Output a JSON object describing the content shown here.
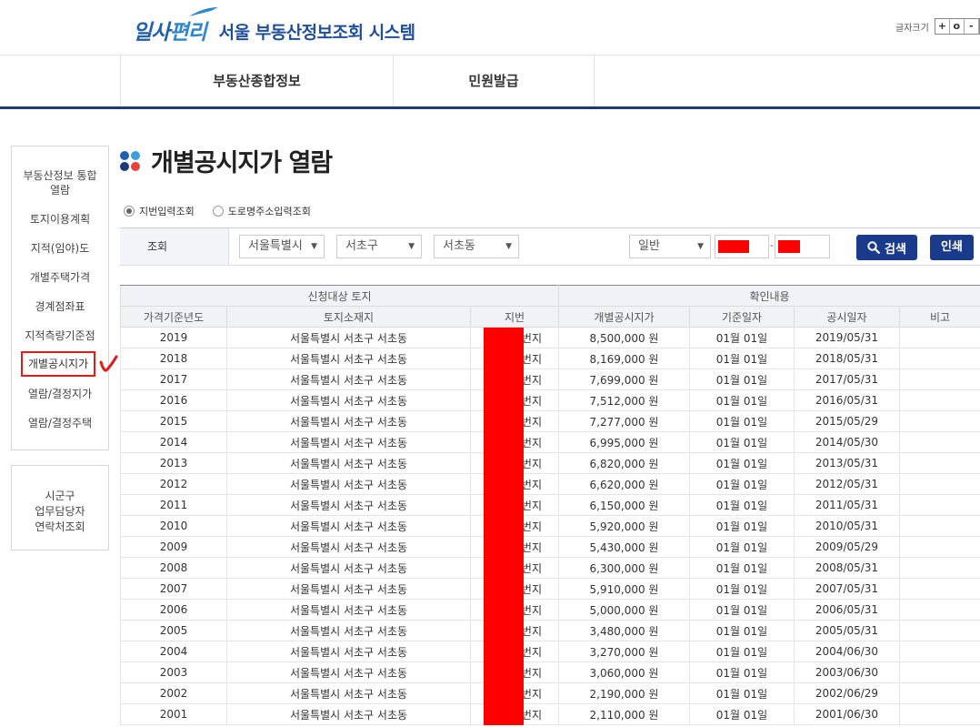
{
  "header": {
    "logo_brand_1": "일사",
    "logo_brand_2": "편리",
    "site_title": "서울 부동산정보조회 시스템",
    "fontsize_label": "글자크기",
    "fontsize_buttons": [
      "+",
      "o",
      "-"
    ]
  },
  "topnav": {
    "items": [
      "부동산종합정보",
      "민원발급"
    ]
  },
  "sidebar": {
    "items": [
      "부동산정보 통합\n열람",
      "토지이용계획",
      "지적(임야)도",
      "개별주택가격",
      "경계점좌표",
      "지적측량기준점",
      "개별공시지가",
      "열람/결정지가",
      "열람/결정주택"
    ],
    "contact": "시군구\n업무담당자\n연락처조회"
  },
  "page": {
    "title": "개별공시지가 열람"
  },
  "search": {
    "radio_options": [
      "지번입력조회",
      "도로명주소입력조회"
    ],
    "label": "조회",
    "sido": "서울특별시",
    "sigungu": "서초구",
    "dong": "서초동",
    "type": "일반",
    "dash": "-",
    "search_button": "검색",
    "print_button": "인쇄"
  },
  "table": {
    "group_headers": [
      "신청대상 토지",
      "확인내용"
    ],
    "headers": [
      "가격기준년도",
      "토지소재지",
      "지번",
      "개별공시지가",
      "기준일자",
      "공시일자",
      "비고"
    ],
    "rows": [
      {
        "year": "2019",
        "location": "서울특별시 서초구 서초동",
        "jibun": "번지",
        "price": "8,500,000 원",
        "base_date": "01월 01일",
        "notice_date": "2019/05/31",
        "note": ""
      },
      {
        "year": "2018",
        "location": "서울특별시 서초구 서초동",
        "jibun": "번지",
        "price": "8,169,000 원",
        "base_date": "01월 01일",
        "notice_date": "2018/05/31",
        "note": ""
      },
      {
        "year": "2017",
        "location": "서울특별시 서초구 서초동",
        "jibun": "번지",
        "price": "7,699,000 원",
        "base_date": "01월 01일",
        "notice_date": "2017/05/31",
        "note": ""
      },
      {
        "year": "2016",
        "location": "서울특별시 서초구 서초동",
        "jibun": "번지",
        "price": "7,512,000 원",
        "base_date": "01월 01일",
        "notice_date": "2016/05/31",
        "note": ""
      },
      {
        "year": "2015",
        "location": "서울특별시 서초구 서초동",
        "jibun": "번지",
        "price": "7,277,000 원",
        "base_date": "01월 01일",
        "notice_date": "2015/05/29",
        "note": ""
      },
      {
        "year": "2014",
        "location": "서울특별시 서초구 서초동",
        "jibun": "번지",
        "price": "6,995,000 원",
        "base_date": "01월 01일",
        "notice_date": "2014/05/30",
        "note": ""
      },
      {
        "year": "2013",
        "location": "서울특별시 서초구 서초동",
        "jibun": "번지",
        "price": "6,820,000 원",
        "base_date": "01월 01일",
        "notice_date": "2013/05/31",
        "note": ""
      },
      {
        "year": "2012",
        "location": "서울특별시 서초구 서초동",
        "jibun": "번지",
        "price": "6,620,000 원",
        "base_date": "01월 01일",
        "notice_date": "2012/05/31",
        "note": ""
      },
      {
        "year": "2011",
        "location": "서울특별시 서초구 서초동",
        "jibun": "번지",
        "price": "6,150,000 원",
        "base_date": "01월 01일",
        "notice_date": "2011/05/31",
        "note": ""
      },
      {
        "year": "2010",
        "location": "서울특별시 서초구 서초동",
        "jibun": "번지",
        "price": "5,920,000 원",
        "base_date": "01월 01일",
        "notice_date": "2010/05/31",
        "note": ""
      },
      {
        "year": "2009",
        "location": "서울특별시 서초구 서초동",
        "jibun": "번지",
        "price": "5,430,000 원",
        "base_date": "01월 01일",
        "notice_date": "2009/05/29",
        "note": ""
      },
      {
        "year": "2008",
        "location": "서울특별시 서초구 서초동",
        "jibun": "번지",
        "price": "6,300,000 원",
        "base_date": "01월 01일",
        "notice_date": "2008/05/31",
        "note": ""
      },
      {
        "year": "2007",
        "location": "서울특별시 서초구 서초동",
        "jibun": "번지",
        "price": "5,910,000 원",
        "base_date": "01월 01일",
        "notice_date": "2007/05/31",
        "note": ""
      },
      {
        "year": "2006",
        "location": "서울특별시 서초구 서초동",
        "jibun": "번지",
        "price": "5,000,000 원",
        "base_date": "01월 01일",
        "notice_date": "2006/05/31",
        "note": ""
      },
      {
        "year": "2005",
        "location": "서울특별시 서초구 서초동",
        "jibun": "번지",
        "price": "3,480,000 원",
        "base_date": "01월 01일",
        "notice_date": "2005/05/31",
        "note": ""
      },
      {
        "year": "2004",
        "location": "서울특별시 서초구 서초동",
        "jibun": "번지",
        "price": "3,270,000 원",
        "base_date": "01월 01일",
        "notice_date": "2004/06/30",
        "note": ""
      },
      {
        "year": "2003",
        "location": "서울특별시 서초구 서초동",
        "jibun": "번지",
        "price": "3,060,000 원",
        "base_date": "01월 01일",
        "notice_date": "2003/06/30",
        "note": ""
      },
      {
        "year": "2002",
        "location": "서울특별시 서초구 서초동",
        "jibun": "번지",
        "price": "2,190,000 원",
        "base_date": "01월 01일",
        "notice_date": "2002/06/29",
        "note": ""
      },
      {
        "year": "2001",
        "location": "서울특별시 서초구 서초동",
        "jibun": "번지",
        "price": "2,110,000 원",
        "base_date": "01월 01일",
        "notice_date": "2001/06/30",
        "note": ""
      }
    ]
  },
  "colors": {
    "brand_blue": "#1f5fae",
    "nav_bar": "#1a3a7a",
    "button_blue": "#1a3a8c",
    "redaction_red": "#ff0000",
    "highlight_red": "#e21a1a",
    "dot_blue_1": "#1f5fae",
    "dot_blue_2": "#3ca0dc",
    "dot_blue_3": "#1a3a7a",
    "dot_red": "#e8433b"
  },
  "icons": {
    "search": "search-icon",
    "radio": "radio-icon",
    "caret": "chevron-down-icon",
    "check": "checkmark-annotation-icon"
  }
}
